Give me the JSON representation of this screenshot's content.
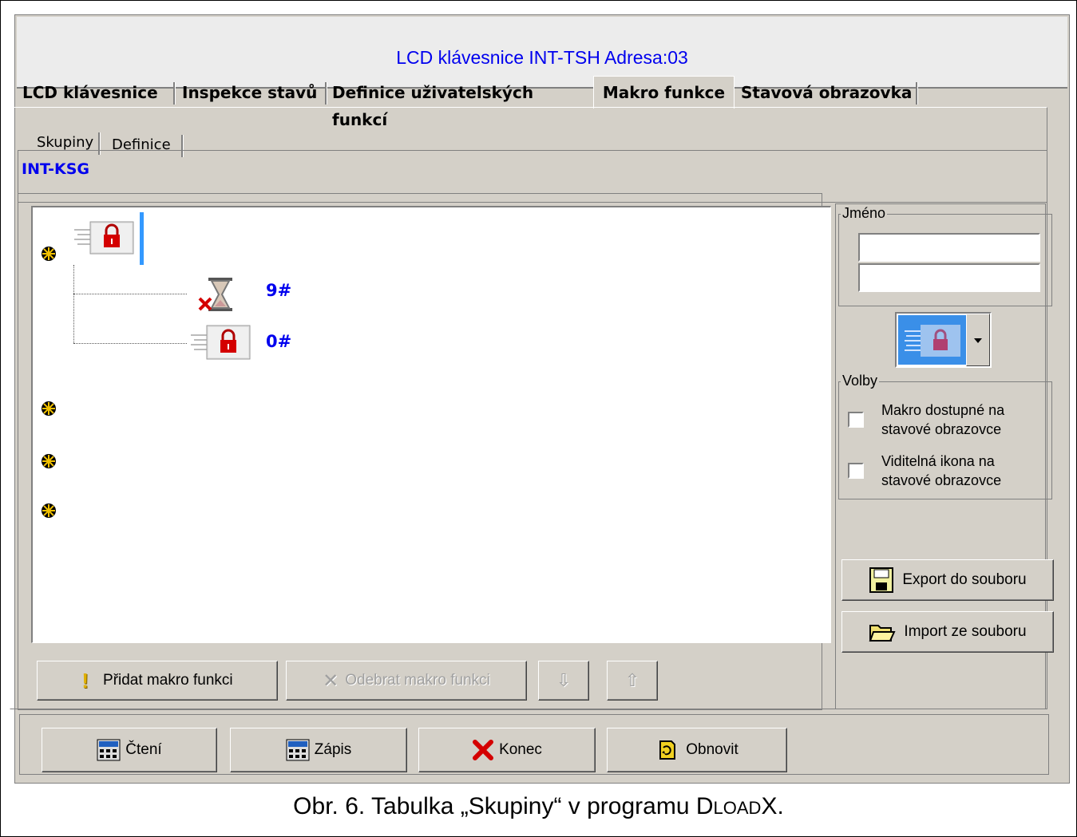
{
  "window": {
    "title": "LCD klávesnice INT-TSH Adresa:03"
  },
  "tabs": [
    {
      "label": "LCD klávesnice"
    },
    {
      "label": "Inspekce stavů"
    },
    {
      "label": "Definice uživatelských funkcí"
    },
    {
      "label": "Makro funkce"
    },
    {
      "label": "Stavová obrazovka"
    }
  ],
  "subtabs": [
    {
      "label": "Skupiny"
    },
    {
      "label": "Definice"
    }
  ],
  "group_name": "INT-KSG",
  "tree": {
    "items": [
      {
        "label": "9#",
        "icon": "hourglass-cancel-icon"
      },
      {
        "label": "0#",
        "icon": "lock-icon"
      }
    ]
  },
  "buttons": {
    "add": "Přidat makro funkci",
    "remove": "Odebrat makro funkci",
    "export": "Export do souboru",
    "import": "Import ze souboru",
    "read": "Čtení",
    "write": "Zápis",
    "close": "Konec",
    "refresh": "Obnovit"
  },
  "name_group": {
    "legend": "Jméno",
    "line1": "",
    "line2": ""
  },
  "options": {
    "legend": "Volby",
    "opt1": "Makro dostupné na stavové obrazovce",
    "opt1_a": "Makro dostupné na",
    "opt1_b": "stavové obrazovce",
    "opt2_a": "Viditelná ikona na",
    "opt2_b": "stavové obrazovce"
  },
  "caption": {
    "prefix": "Obr. 6. Tabulka „Skupiny“ v programu ",
    "d": "D",
    "load": "LOAD",
    "x": "X."
  },
  "colors": {
    "accent_text": "#0000ee",
    "window_bg": "#d4d0c8",
    "lock_red": "#d40000"
  }
}
